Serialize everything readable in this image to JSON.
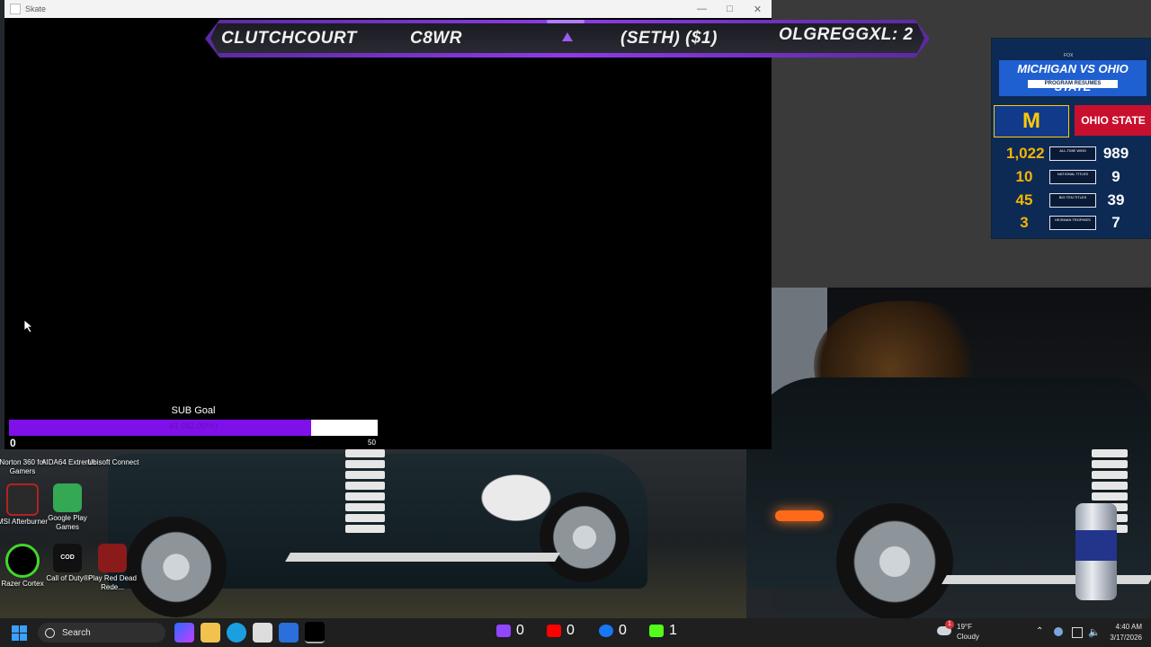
{
  "window": {
    "title": "Skate"
  },
  "scoreboard": {
    "team_left": "CLUTCHCOURT",
    "player_left": "C8WR",
    "wager": "(SETH) ($1)",
    "team_right_score": "OLGREGGXL: 2"
  },
  "sub_goal": {
    "label": "SUB Goal",
    "progress_text": "41 (82.00%)",
    "progress_fraction": 0.82,
    "min": "0",
    "max": "50"
  },
  "graphic": {
    "brand": "FOX",
    "title": "MICHIGAN VS OHIO STATE",
    "subtitle": "PROGRAM RESUMES",
    "team_left": "M",
    "team_right": "OHIO STATE",
    "rows": [
      {
        "left": "1,022",
        "label": "ALL-TIME WINS",
        "right": "989"
      },
      {
        "left": "10",
        "label": "NATIONAL TITLES",
        "right": "9"
      },
      {
        "left": "45",
        "label": "BIG TEN TITLES",
        "right": "39"
      },
      {
        "left": "3",
        "label": "HEISMAN TROPHIES",
        "right": "7"
      }
    ]
  },
  "desktop_icons": [
    {
      "label": "Norton 360 for Gamers",
      "icon": "norton-icon",
      "color": "#f4c20d"
    },
    {
      "label": "AIDA64 Extreme",
      "icon": "aida64-icon",
      "color": "#c0392b"
    },
    {
      "label": "Ubisoft Connect",
      "icon": "ubisoft-icon",
      "color": "#2d6cdf"
    },
    {
      "label": "MSI Afterburner",
      "icon": "msi-afterburner-icon",
      "color": "#b22222"
    },
    {
      "label": "Google Play Games",
      "icon": "google-play-games-icon",
      "color": "#34a853"
    },
    {
      "label": "Razer Cortex",
      "icon": "razer-cortex-icon",
      "color": "#44d62c"
    },
    {
      "label": "Call of Duty®",
      "icon": "call-of-duty-icon",
      "color": "#111111"
    },
    {
      "label": "Play Red Dead Rede...",
      "icon": "red-dead-icon",
      "color": "#8b1a1a"
    }
  ],
  "taskbar": {
    "search_placeholder": "Search",
    "weather_temp": "19°F",
    "weather_desc": "Cloudy",
    "weather_badge": "1",
    "time": "4:40 AM",
    "date": "3/17/2026"
  },
  "stream_stats": [
    {
      "icon": "twitch-icon",
      "color": "#9146ff",
      "value": "0"
    },
    {
      "icon": "youtube-icon",
      "color": "#ff0000",
      "value": "0"
    },
    {
      "icon": "facebook-icon",
      "color": "#1877f2",
      "value": "0"
    },
    {
      "icon": "kick-icon",
      "color": "#53fc18",
      "value": "1"
    }
  ]
}
